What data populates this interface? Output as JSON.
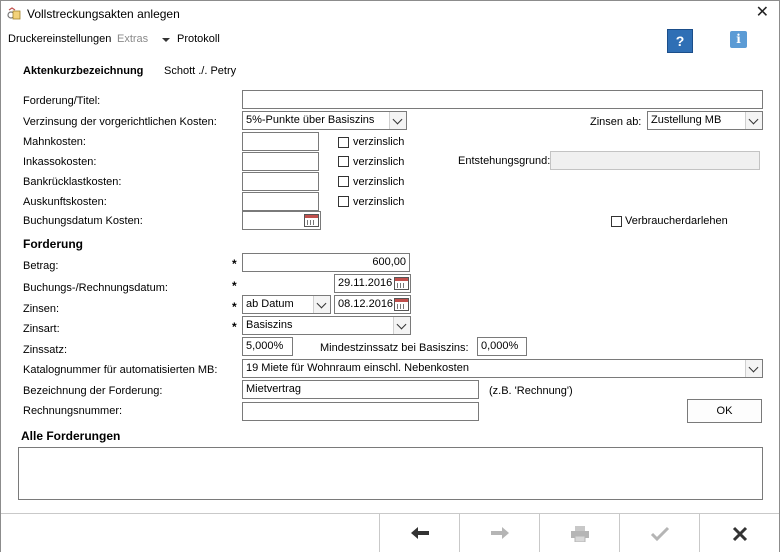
{
  "window": {
    "title": "Vollstreckungsakten anlegen",
    "close_glyph": "✕"
  },
  "menubar": {
    "items": [
      {
        "label": "Druckereinstellungen",
        "disabled": false
      },
      {
        "label": "Extras",
        "disabled": true
      },
      {
        "label": "Protokoll",
        "disabled": false
      }
    ],
    "help_glyph": "?",
    "info_glyph": "i"
  },
  "header": {
    "label": "Aktenkurzbezeichnung",
    "value": "Schott ./. Petry"
  },
  "costs": {
    "forderung_titel_label": "Forderung/Titel:",
    "forderung_titel_value": "",
    "verzinsung_label": "Verzinsung der vorgerichtlichen Kosten:",
    "verzinsung_value": "5%-Punkte über Basiszins",
    "zinsen_ab_label": "Zinsen ab:",
    "zinsen_ab_value": "Zustellung MB",
    "mahnkosten_label": "Mahnkosten:",
    "inkassokosten_label": "Inkassokosten:",
    "bankruecklast_label": "Bankrücklastkosten:",
    "auskunft_label": "Auskunftskosten:",
    "verzinslich_label": "verzinslich",
    "entstehungsgrund_label": "Entstehungsgrund:",
    "buchungsdatum_kosten_label": "Buchungsdatum Kosten:",
    "verbraucher_label": "Verbraucherdarlehen"
  },
  "forderung": {
    "section_title": "Forderung",
    "required_mark": "*",
    "betrag_label": "Betrag:",
    "betrag_value": "600,00",
    "buchungsdatum_label": "Buchungs-/Rechnungsdatum:",
    "buchungsdatum_value": "29.11.2016",
    "zinsen_label": "Zinsen:",
    "zinsen_mode_value": "ab Datum",
    "zinsen_date_value": "08.12.2016",
    "zinsart_label": "Zinsart:",
    "zinsart_value": "Basiszins",
    "zinssatz_label": "Zinssatz:",
    "zinssatz_value": "5,000%",
    "mindest_label": "Mindestzinssatz bei Basiszins:",
    "mindest_value": "0,000%",
    "katalog_label": "Katalognummer für automatisierten MB:",
    "katalog_value": "19 Miete für Wohnraum einschl. Nebenkosten",
    "bezeichnung_label": "Bezeichnung der Forderung:",
    "bezeichnung_value": "Mietvertrag",
    "bezeichnung_hint": "(z.B. 'Rechnung')",
    "rechnungsnummer_label": "Rechnungsnummer:",
    "rechnungsnummer_value": "",
    "ok_label": "OK"
  },
  "alle": {
    "section_title": "Alle Forderungen"
  },
  "footer": {
    "buttons": [
      "back-arrow-icon",
      "forward-arrow-icon",
      "print-icon",
      "checkmark-icon",
      "cancel-x-icon"
    ]
  }
}
